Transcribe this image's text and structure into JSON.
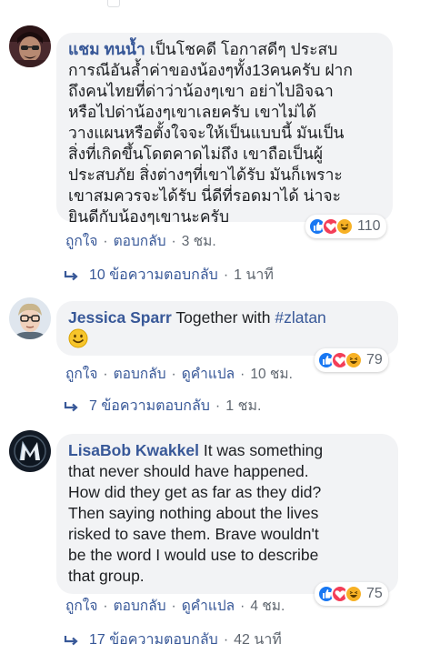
{
  "comments": [
    {
      "author": "แชม ทนน้ำ",
      "lines": [
        "เป็นโชคดี โอกาสดีๆ ประสบ",
        "การณีอันล้ำค่าของน้องๆทั้ง13คนครับ ฝาก",
        "ถึงคนไทยที่ด่าว่าน้องๆเขา อย่าไปอิจฉา",
        "หรือไปด่าน้องๆเขาเลยครับ เขาไม่ได้",
        "วางแผนหรือตั้งใจจะให้เป็นแบบนี้ มันเป็น",
        "สิ่งที่เกิดขึ้นโดตคาดไม่ถึง เขาถือเป็นผู้",
        "ประสบภัย สิ่งต่างๆที่เขาได้รับ มันก็เพราะ",
        "เขาสมควรจะได้รับ นี่ดีที่รอดมาได้ น่าจะ",
        "ยินดีกับน้องๆเขานะครับ"
      ],
      "reaction_count": "110",
      "actions": [
        "ถูกใจ",
        "ตอบกลับ"
      ],
      "time": "3 ชม.",
      "replies_label": "10 ข้อความตอบกลับ",
      "replies_time": "1 นาที"
    },
    {
      "author": "Jessica Sparr",
      "text": "Together with",
      "hashtag": "#zlatan",
      "emoji": "smiley",
      "reaction_count": "79",
      "actions": [
        "ถูกใจ",
        "ตอบกลับ",
        "ดูคำแปล"
      ],
      "time": "10 ชม.",
      "replies_label": "7 ข้อความตอบกลับ",
      "replies_time": "1 ชม."
    },
    {
      "author": "LisaBob Kwakkel",
      "lines": [
        "It was something",
        "that never should have happened.",
        "How did they get as far as they did?",
        "Then saying nothing about the lives",
        "risked to save them. Brave wouldn't",
        "be the word I would use to describe",
        "that group."
      ],
      "reaction_count": "75",
      "actions": [
        "ถูกใจ",
        "ตอบกลับ",
        "ดูคำแปล"
      ],
      "time": "4 ชม.",
      "replies_label": "17 ข้อความตอบกลับ",
      "replies_time": "42 นาที"
    }
  ],
  "colors": {
    "link": "#385898",
    "bubble": "#f2f3f5",
    "meta": "#606770",
    "like": "#1877f2",
    "love": "#f33e58",
    "haha": "#f7b125"
  }
}
